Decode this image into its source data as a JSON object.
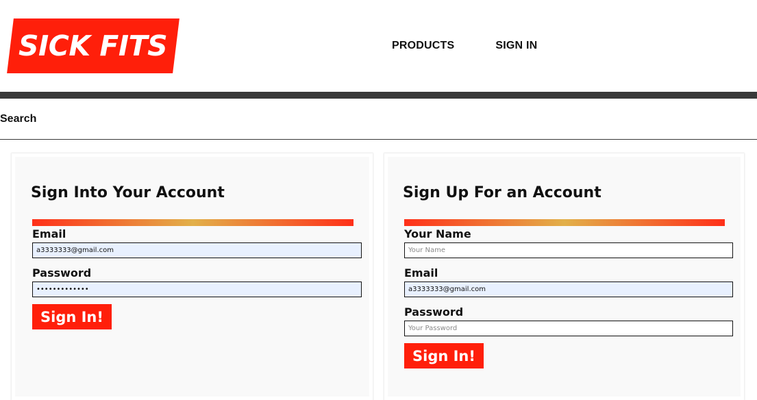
{
  "header": {
    "logo_text": "SICK FITS",
    "nav": [
      {
        "label": "PRODUCTS"
      },
      {
        "label": "SIGN IN"
      }
    ]
  },
  "search": {
    "label": "Search"
  },
  "signin": {
    "title": "Sign Into Your Account",
    "email_label": "Email",
    "email_value": "a3333333@gmail.com",
    "password_label": "Password",
    "password_value": "•••••••••••••",
    "submit_label": "Sign In!"
  },
  "signup": {
    "title": "Sign Up For an Account",
    "name_label": "Your Name",
    "name_placeholder": "Your Name",
    "email_label": "Email",
    "email_value": "a3333333@gmail.com",
    "password_label": "Password",
    "password_placeholder": "Your Password",
    "submit_label": "Sign In!"
  },
  "colors": {
    "brand": "#ff1f0a",
    "bar": "#393939",
    "autofill": "#e8f0fe"
  }
}
